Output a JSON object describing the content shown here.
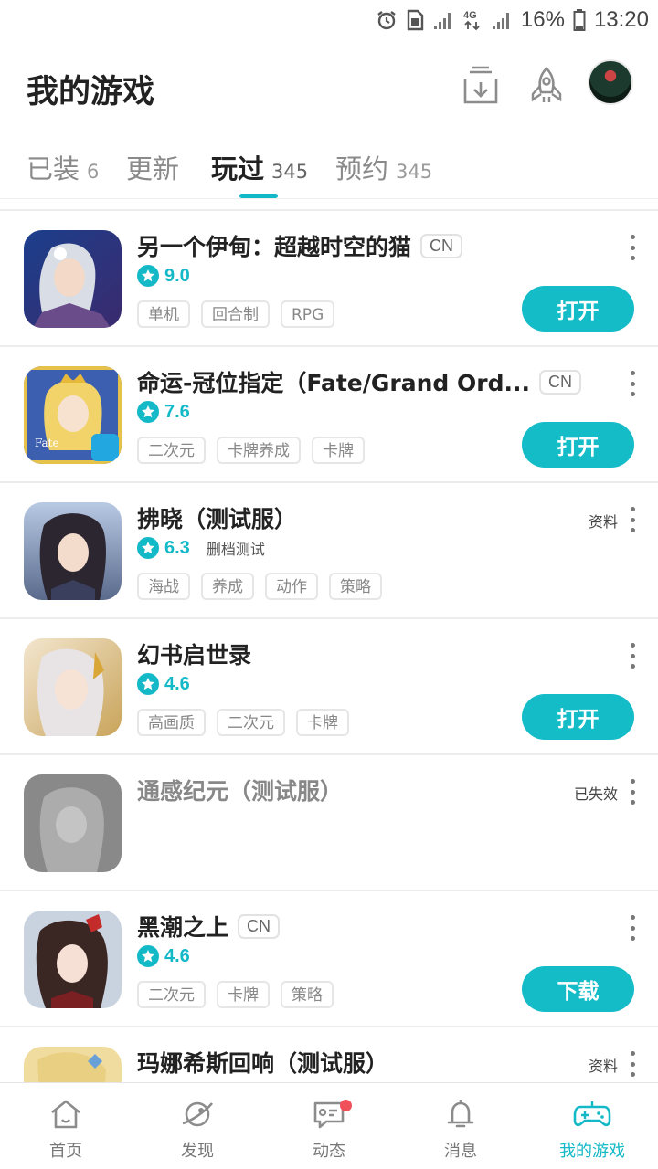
{
  "status_bar": {
    "battery": "16%",
    "time": "13:20",
    "network": "4G"
  },
  "header": {
    "title": "我的游戏"
  },
  "tabs": [
    {
      "label": "已装",
      "count": "6"
    },
    {
      "label": "更新",
      "count": ""
    },
    {
      "label": "玩过",
      "count": "345",
      "active": true
    },
    {
      "label": "预约",
      "count": "345"
    }
  ],
  "games": [
    {
      "title": "另一个伊甸：超越时空的猫",
      "badge": "CN",
      "score": "9.0",
      "note": "",
      "tags": [
        "单机",
        "回合制",
        "RPG"
      ],
      "side": "",
      "action": "打开"
    },
    {
      "title": "命运-冠位指定（Fate/Grand Ord...",
      "badge": "CN",
      "score": "7.6",
      "note": "",
      "tags": [
        "二次元",
        "卡牌养成",
        "卡牌"
      ],
      "side": "",
      "action": "打开"
    },
    {
      "title": "拂晓（测试服）",
      "badge": "",
      "score": "6.3",
      "note": "删档测试",
      "tags": [
        "海战",
        "养成",
        "动作",
        "策略"
      ],
      "side": "资料",
      "action": ""
    },
    {
      "title": "幻书启世录",
      "badge": "",
      "score": "4.6",
      "note": "",
      "tags": [
        "高画质",
        "二次元",
        "卡牌"
      ],
      "side": "",
      "action": "打开"
    },
    {
      "title": "通感纪元（测试服）",
      "badge": "",
      "score": "",
      "note": "",
      "tags": [],
      "side": "已失效",
      "action": ""
    },
    {
      "title": "黑潮之上",
      "badge": "CN",
      "score": "4.6",
      "note": "",
      "tags": [
        "二次元",
        "卡牌",
        "策略"
      ],
      "side": "",
      "action": "下载"
    },
    {
      "title": "玛娜希斯回响（测试服）",
      "badge": "",
      "score": "",
      "note": "",
      "tags": [],
      "side": "资料",
      "action": ""
    }
  ],
  "bottom_nav": [
    {
      "label": "首页",
      "icon": "home-icon"
    },
    {
      "label": "发现",
      "icon": "planet-icon"
    },
    {
      "label": "动态",
      "icon": "chat-icon",
      "dot": true
    },
    {
      "label": "消息",
      "icon": "bell-icon"
    },
    {
      "label": "我的游戏",
      "icon": "gamepad-icon",
      "active": true
    }
  ],
  "colors": {
    "accent": "#14b9c8",
    "notify_dot": "#f0505a"
  }
}
